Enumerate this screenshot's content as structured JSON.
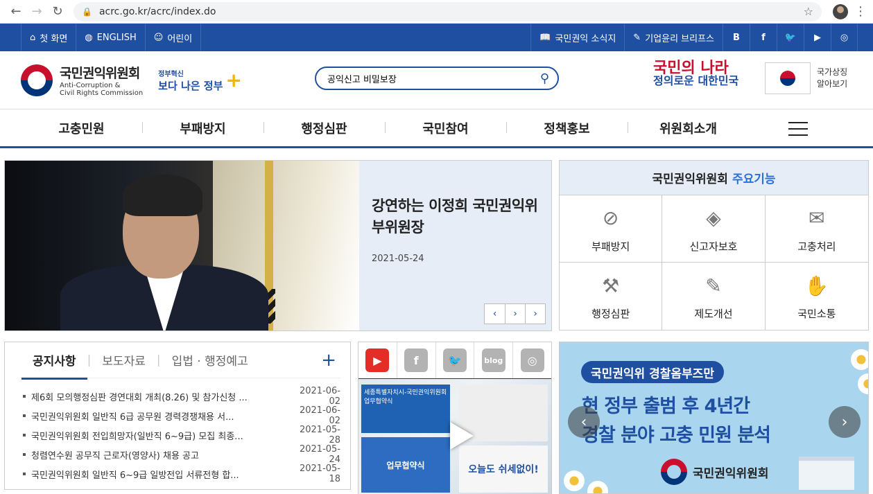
{
  "browser": {
    "url": "acrc.go.kr/acrc/index.do",
    "back": "←",
    "forward": "→",
    "reload": "↻",
    "lock": "🔒",
    "star": "☆",
    "menu": "⋮"
  },
  "util": {
    "left": [
      {
        "icon": "⌂",
        "label": "첫 화면"
      },
      {
        "icon": "◍",
        "label": "ENGLISH"
      },
      {
        "icon": "☺",
        "label": "어린이"
      }
    ],
    "right": [
      {
        "icon": "📖",
        "label": "국민권익 소식지"
      },
      {
        "icon": "✎",
        "label": "기업윤리 브리프스"
      }
    ],
    "social": [
      "B",
      "f",
      "🐦",
      "▶",
      "◎"
    ]
  },
  "header": {
    "org_ko": "국민권익위원회",
    "org_en_1": "Anti-Corruption &",
    "org_en_2": "Civil Rights Commission",
    "gov_small": "정부혁신",
    "gov_big": "보다 나은 정부",
    "search_value": "공익신고 비밀보장",
    "slogan_1": "국민의 나라",
    "slogan_2": "정의로운 대한민국",
    "flag_label_1": "국가상징",
    "flag_label_2": "알아보기"
  },
  "nav": [
    "고충민원",
    "부패방지",
    "행정심판",
    "국민참여",
    "정책홍보",
    "위원회소개"
  ],
  "hero": {
    "title": "강연하는 이정희 국민권익위 부위원장",
    "date": "2021-05-24",
    "prev": "‹",
    "play": "›",
    "next": "›"
  },
  "keyfn": {
    "title": "국민권익위원회",
    "accent": "주요기능",
    "items": [
      {
        "icon": "⊘",
        "label": "부패방지"
      },
      {
        "icon": "◈",
        "label": "신고자보호"
      },
      {
        "icon": "✉",
        "label": "고충처리"
      },
      {
        "icon": "⚒",
        "label": "행정심판"
      },
      {
        "icon": "✎",
        "label": "제도개선"
      },
      {
        "icon": "✋",
        "label": "국민소통"
      }
    ]
  },
  "notice": {
    "tabs": [
      "공지사항",
      "보도자료",
      "입법 · 행정예고"
    ],
    "plus": "+",
    "items": [
      {
        "title": "제6회 모의행정심판 경연대회 개최(8.26) 및 참가신청 ...",
        "date": "2021-06-02"
      },
      {
        "title": "국민권익위원회 일반직 6급 공무원 경력경쟁채용 서...",
        "date": "2021-06-02"
      },
      {
        "title": "국민권익위원회 전입희망자(일반직 6~9급) 모집 최종...",
        "date": "2021-05-28"
      },
      {
        "title": "청렴연수원 공무직 근로자(영양사) 채용 공고",
        "date": "2021-05-24"
      },
      {
        "title": "국민권익위원회 일반직 6~9급 일방전입 서류전형 합...",
        "date": "2021-05-18"
      }
    ]
  },
  "social": {
    "icons": [
      "▶",
      "f",
      "🐦",
      "blog",
      "◎"
    ],
    "video_a": "세종특별자치시-국민권익위원회 업무협약식",
    "video_b": "업무협약식",
    "video_d": "오늘도 쉬세없이!"
  },
  "promo": {
    "pill": "국민권익위 경찰옴부즈만",
    "line1": "현 정부 출범 후 4년간",
    "line2": "경찰 분야 고충 민원 분석",
    "org": "국민권익위원회",
    "prev": "‹",
    "next": "›"
  }
}
